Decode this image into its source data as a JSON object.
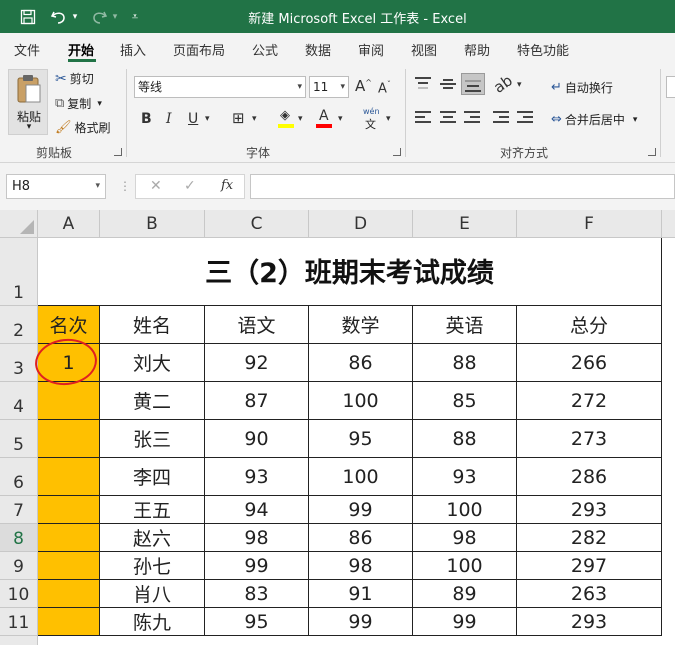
{
  "window": {
    "title": "新建 Microsoft Excel 工作表  -  Excel"
  },
  "qat": {
    "save_icon": "save-icon",
    "undo_icon": "undo-icon",
    "redo_icon": "redo-icon",
    "customize_icon": "customize-icon"
  },
  "menu": {
    "tabs": [
      "文件",
      "开始",
      "插入",
      "页面布局",
      "公式",
      "数据",
      "审阅",
      "视图",
      "帮助",
      "特色功能"
    ],
    "active": "开始"
  },
  "ribbon": {
    "clipboard": {
      "paste": "粘贴",
      "cut": "剪切",
      "copy": "复制",
      "format_painter": "格式刷",
      "group_label": "剪贴板"
    },
    "font": {
      "font_name": "等线",
      "font_size": "11",
      "grow": "A",
      "shrink": "A",
      "bold": "B",
      "italic": "I",
      "underline": "U",
      "font_color_letter": "A",
      "wen": "wén",
      "wen_char": "文",
      "group_label": "字体",
      "fill_color": "#ffff00",
      "font_color": "#ff0000"
    },
    "alignment": {
      "wrap_text": "自动换行",
      "merge_center": "合并后居中",
      "group_label": "对齐方式"
    }
  },
  "formula_bar": {
    "name_box": "H8",
    "cancel": "✕",
    "enter": "✓",
    "fx": "fx",
    "value": ""
  },
  "sheet": {
    "columns": [
      "A",
      "B",
      "C",
      "D",
      "E",
      "F"
    ],
    "rows": [
      "1",
      "2",
      "3",
      "4",
      "5",
      "6",
      "7",
      "8",
      "9",
      "10",
      "11"
    ],
    "selected_row": "8",
    "title": "三（2）班期末考试成绩",
    "headers": [
      "名次",
      "姓名",
      "语文",
      "数学",
      "英语",
      "总分"
    ],
    "data": [
      [
        "1",
        "刘大",
        "92",
        "86",
        "88",
        "266"
      ],
      [
        "",
        "黄二",
        "87",
        "100",
        "85",
        "272"
      ],
      [
        "",
        "张三",
        "90",
        "95",
        "88",
        "273"
      ],
      [
        "",
        "李四",
        "93",
        "100",
        "93",
        "286"
      ],
      [
        "",
        "王五",
        "94",
        "99",
        "100",
        "293"
      ],
      [
        "",
        "赵六",
        "98",
        "86",
        "98",
        "282"
      ],
      [
        "",
        "孙七",
        "99",
        "98",
        "100",
        "297"
      ],
      [
        "",
        "肖八",
        "83",
        "91",
        "89",
        "263"
      ],
      [
        "",
        "陈九",
        "95",
        "99",
        "99",
        "293"
      ]
    ],
    "rank_fill_color": "#ffc000",
    "annotation_color": "#e02020"
  }
}
